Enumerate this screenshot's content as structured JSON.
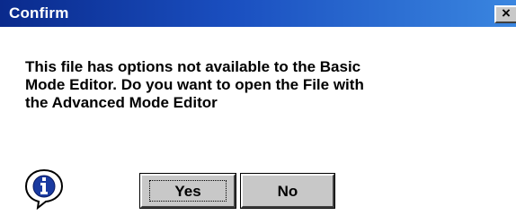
{
  "window": {
    "title": "Confirm",
    "close_glyph": "×",
    "title_bar_color": "#1a4fc0"
  },
  "message": {
    "line1": "This file has options not available to the Basic",
    "line2": "Mode Editor. Do you want to open the File with",
    "line3": "the Advanced Mode Editor"
  },
  "icon": {
    "type": "information-icon"
  },
  "buttons": {
    "yes_label": "Yes",
    "no_label": "No",
    "default": "yes"
  }
}
